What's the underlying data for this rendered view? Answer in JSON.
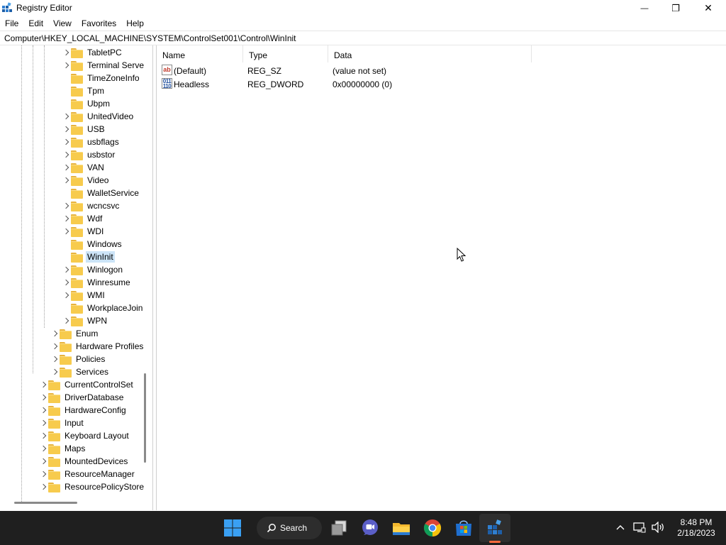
{
  "window": {
    "title": "Registry Editor",
    "minimize_glyph": "—",
    "restore_glyph": "❐",
    "close_glyph": "✕"
  },
  "menu": [
    "File",
    "Edit",
    "View",
    "Favorites",
    "Help"
  ],
  "address": "Computer\\HKEY_LOCAL_MACHINE\\SYSTEM\\ControlSet001\\Control\\WinInit",
  "tree": {
    "level3": [
      {
        "label": "TabletPC",
        "expandable": true
      },
      {
        "label": "Terminal Serve",
        "expandable": true
      },
      {
        "label": "TimeZoneInfo",
        "expandable": false
      },
      {
        "label": "Tpm",
        "expandable": false
      },
      {
        "label": "Ubpm",
        "expandable": false
      },
      {
        "label": "UnitedVideo",
        "expandable": true
      },
      {
        "label": "USB",
        "expandable": true
      },
      {
        "label": "usbflags",
        "expandable": true
      },
      {
        "label": "usbstor",
        "expandable": true
      },
      {
        "label": "VAN",
        "expandable": true
      },
      {
        "label": "Video",
        "expandable": true
      },
      {
        "label": "WalletService",
        "expandable": false
      },
      {
        "label": "wcncsvc",
        "expandable": true
      },
      {
        "label": "Wdf",
        "expandable": true
      },
      {
        "label": "WDI",
        "expandable": true
      },
      {
        "label": "Windows",
        "expandable": false
      },
      {
        "label": "WinInit",
        "expandable": false,
        "selected": true
      },
      {
        "label": "Winlogon",
        "expandable": true
      },
      {
        "label": "Winresume",
        "expandable": true
      },
      {
        "label": "WMI",
        "expandable": true
      },
      {
        "label": "WorkplaceJoin",
        "expandable": false
      },
      {
        "label": "WPN",
        "expandable": true
      }
    ],
    "level2": [
      {
        "label": "Enum"
      },
      {
        "label": "Hardware Profiles"
      },
      {
        "label": "Policies"
      },
      {
        "label": "Services"
      }
    ],
    "level1": [
      {
        "label": "CurrentControlSet"
      },
      {
        "label": "DriverDatabase"
      },
      {
        "label": "HardwareConfig"
      },
      {
        "label": "Input"
      },
      {
        "label": "Keyboard Layout"
      },
      {
        "label": "Maps"
      },
      {
        "label": "MountedDevices"
      },
      {
        "label": "ResourceManager"
      },
      {
        "label": "ResourcePolicyStore"
      }
    ]
  },
  "values": {
    "columns": [
      "Name",
      "Type",
      "Data"
    ],
    "rows": [
      {
        "icon": "string-value-icon",
        "icon_text": "ab",
        "name": "(Default)",
        "type": "REG_SZ",
        "data": "(value not set)"
      },
      {
        "icon": "binary-value-icon",
        "icon_text": "011\n110",
        "name": "Headless",
        "type": "REG_DWORD",
        "data": "0x00000000 (0)"
      }
    ]
  },
  "taskbar": {
    "search_label": "Search",
    "time": "8:48 PM",
    "date": "2/18/2023",
    "apps": [
      "windows-start-icon",
      "task-view-icon",
      "teams-chat-icon",
      "file-explorer-icon",
      "chrome-icon",
      "microsoft-store-icon",
      "registry-editor-icon"
    ]
  },
  "colors": {
    "selection": "#cce4f7",
    "folder": "#f7cb4d",
    "taskbar": "#1f1f1f",
    "active_indicator": "#ff6a3d"
  }
}
